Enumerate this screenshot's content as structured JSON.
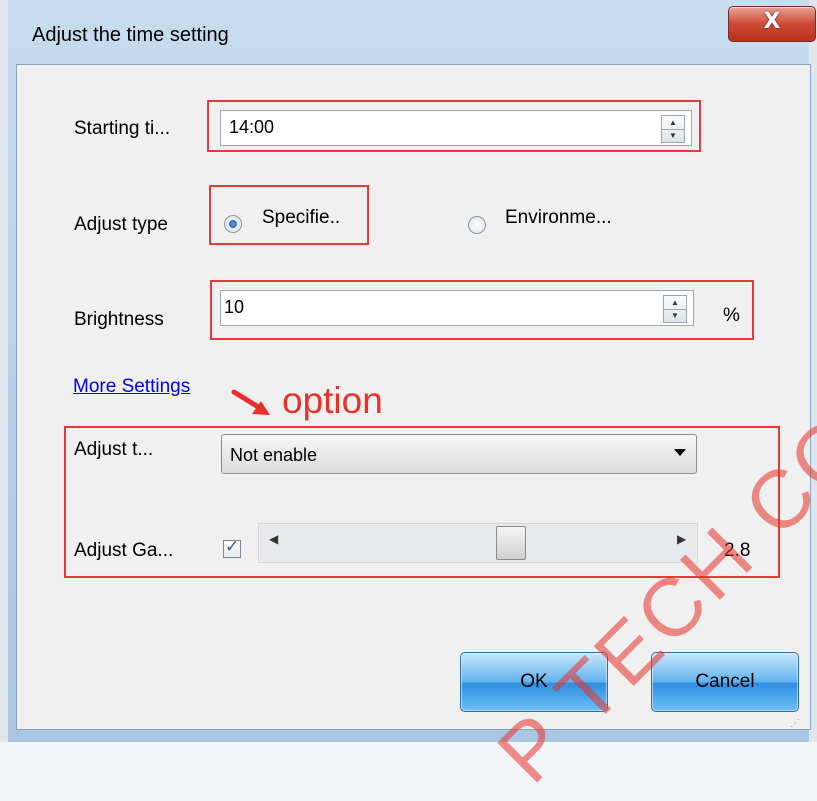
{
  "dialog": {
    "title": "Adjust the time setting",
    "close_glyph": "X"
  },
  "form": {
    "starting_time": {
      "label": "Starting ti...",
      "value": "14:00"
    },
    "adjust_type": {
      "label": "Adjust type",
      "options": [
        {
          "label": "Specifie..",
          "selected": true
        },
        {
          "label": "Environme...",
          "selected": false
        }
      ]
    },
    "brightness": {
      "label": "Brightness",
      "value": "10",
      "unit": "%"
    },
    "more_settings_link": "More Settings",
    "annotation": "option",
    "adjust_t": {
      "label": "Adjust t...",
      "value": "Not enable"
    },
    "adjust_gamma": {
      "label": "Adjust Ga...",
      "checked": true,
      "value": "2.8",
      "slider_level": 0.5
    }
  },
  "buttons": {
    "ok": "OK",
    "cancel": "Cancel"
  },
  "watermark": "P TECH CO",
  "colors": {
    "annotation_red": "#e83a3a",
    "button_blue": "#62b3ee",
    "link_blue": "#0000ee"
  }
}
